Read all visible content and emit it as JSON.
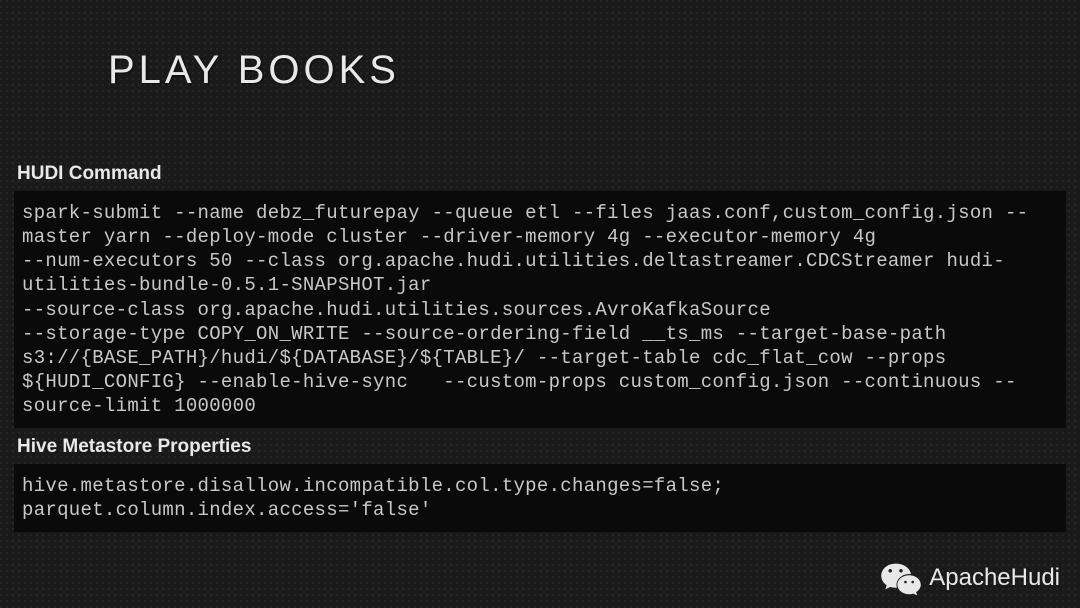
{
  "title": "PLAY BOOKS",
  "sections": {
    "hudi": {
      "heading": "HUDI  Command",
      "code": "spark-submit --name debz_futurepay --queue etl --files jaas.conf,custom_config.json --master yarn --deploy-mode cluster --driver-memory 4g --executor-memory 4g\n--num-executors 50 --class org.apache.hudi.utilities.deltastreamer.CDCStreamer hudi-utilities-bundle-0.5.1-SNAPSHOT.jar\n--source-class org.apache.hudi.utilities.sources.AvroKafkaSource\n--storage-type COPY_ON_WRITE --source-ordering-field __ts_ms --target-base-path  s3://{BASE_PATH}/hudi/${DATABASE}/${TABLE}/ --target-table cdc_flat_cow --props ${HUDI_CONFIG} --enable-hive-sync   --custom-props custom_config.json --continuous --source-limit 1000000"
    },
    "hive": {
      "heading": "Hive Metastore Properties",
      "code": "hive.metastore.disallow.incompatible.col.type.changes=false;\nparquet.column.index.access='false'"
    }
  },
  "footer": {
    "brand": "ApacheHudi",
    "icon": "wechat-icon"
  }
}
